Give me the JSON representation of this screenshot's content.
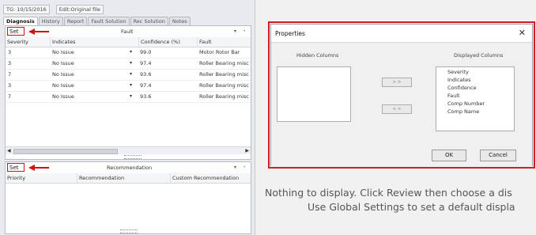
{
  "topbar": {
    "tg": "TG: 10/15/2016",
    "edit": "Edit:Original file"
  },
  "tabs": [
    "Diagnosis",
    "History",
    "Report",
    "Fault Solution",
    "Rec Solution",
    "Notes"
  ],
  "fault_pane": {
    "set_label": "Set",
    "title": "Fault",
    "columns": [
      "Severity",
      "Indicates",
      "Confidence (%)",
      "Fault"
    ],
    "rows": [
      {
        "severity": "3",
        "indicates": "No Issue",
        "confidence": "99.0",
        "fault": "Motor Rotor Bar"
      },
      {
        "severity": "3",
        "indicates": "No Issue",
        "confidence": "97.4",
        "fault": "Roller Bearing misc"
      },
      {
        "severity": "7",
        "indicates": "No Issue",
        "confidence": "93.6",
        "fault": "Roller Bearing misc"
      },
      {
        "severity": "3",
        "indicates": "No Issue",
        "confidence": "97.4",
        "fault": "Roller Bearing misc"
      },
      {
        "severity": "7",
        "indicates": "No Issue",
        "confidence": "93.6",
        "fault": "Roller Bearing misc"
      }
    ]
  },
  "rec_pane": {
    "set_label": "Set",
    "title": "Recommendation",
    "columns": [
      "Priority",
      "Recommendation",
      "Custom Recommendation"
    ]
  },
  "dialog": {
    "title": "Properties",
    "hidden_label": "Hidden Columns",
    "displayed_label": "Displayed Columns",
    "displayed_items": [
      "Severity",
      "Indicates",
      "Confidence",
      "Fault",
      "Comp Number",
      "Comp Name"
    ],
    "move_right": "> >",
    "move_left": "< <",
    "ok": "OK",
    "cancel": "Cancel"
  },
  "message": {
    "line1": "Nothing to display.  Click Review then choose a dis",
    "line2": "Use Global Settings to set a default displa"
  },
  "colors": {
    "highlight_red": "#d01f1f",
    "arrow_red": "#d11111"
  }
}
